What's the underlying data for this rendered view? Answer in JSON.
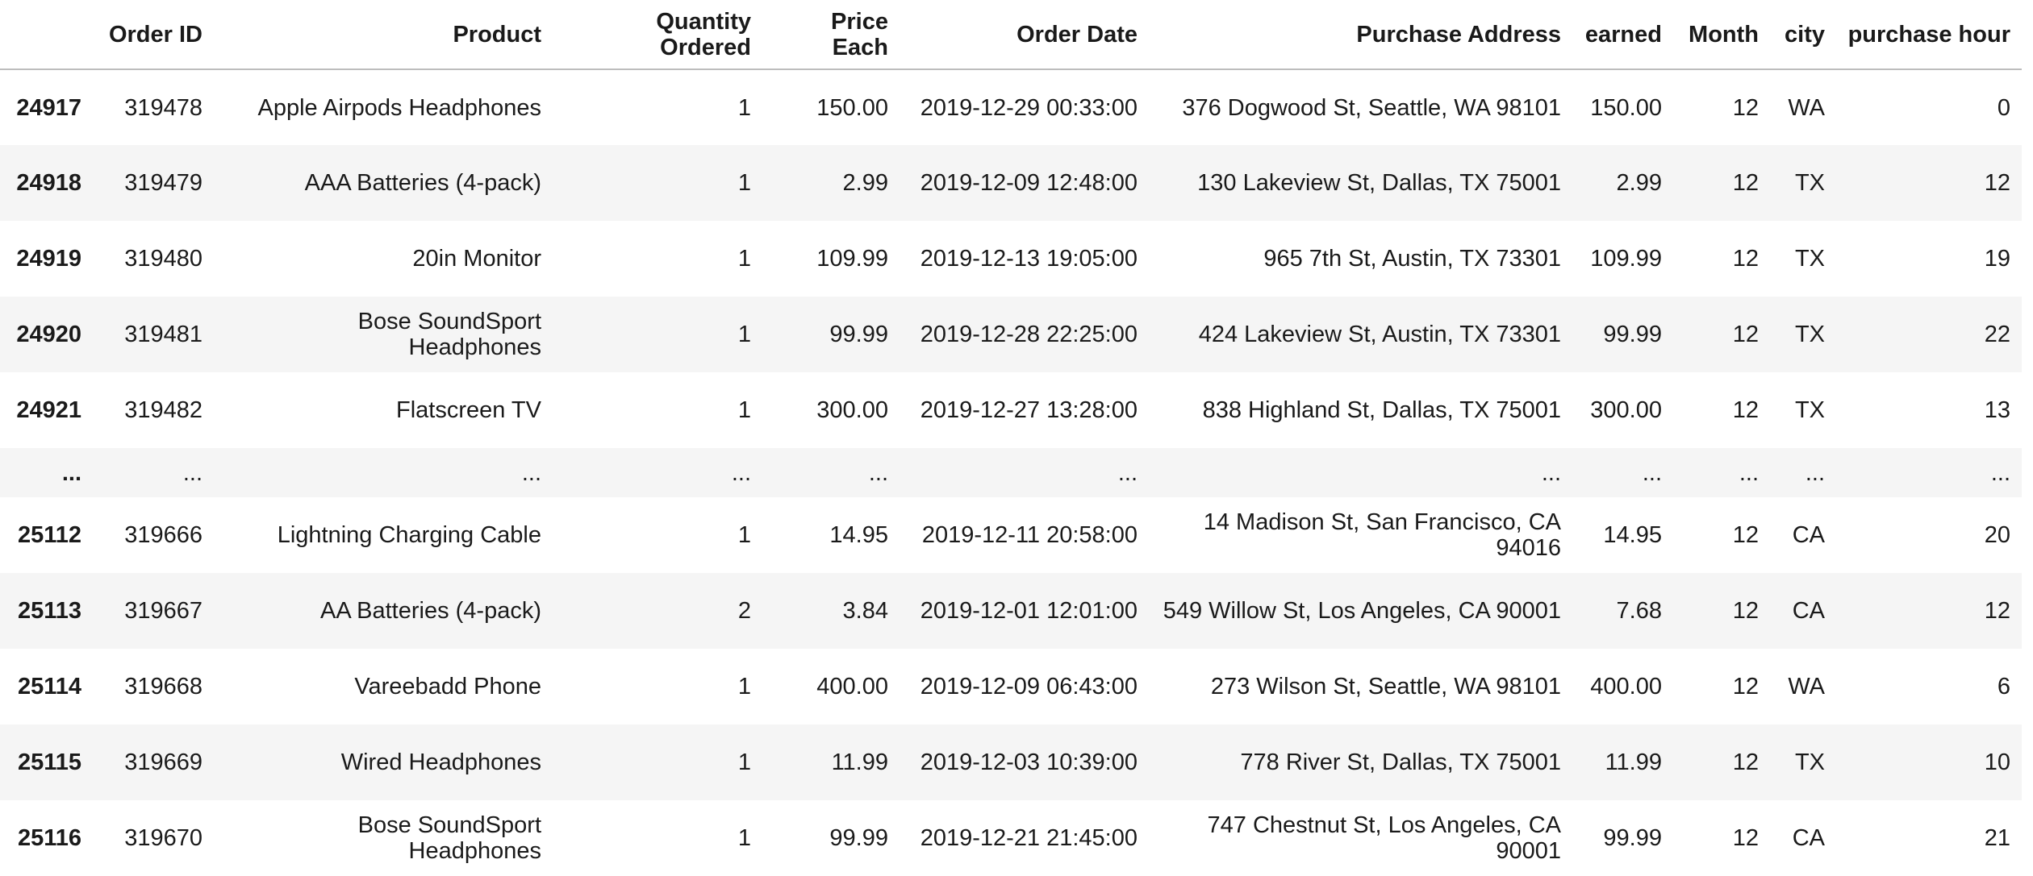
{
  "table": {
    "columns": [
      "",
      "Order ID",
      "Product",
      "Quantity Ordered",
      "Price Each",
      "Order Date",
      "Purchase Address",
      "earned",
      "Month",
      "city",
      "purchase hour"
    ],
    "rows": [
      {
        "index": "24917",
        "cells": [
          "319478",
          "Apple Airpods Headphones",
          "1",
          "150.00",
          "2019-12-29 00:33:00",
          "376 Dogwood St, Seattle, WA 98101",
          "150.00",
          "12",
          "WA",
          "0"
        ]
      },
      {
        "index": "24918",
        "cells": [
          "319479",
          "AAA Batteries (4-pack)",
          "1",
          "2.99",
          "2019-12-09 12:48:00",
          "130 Lakeview St, Dallas, TX 75001",
          "2.99",
          "12",
          "TX",
          "12"
        ]
      },
      {
        "index": "24919",
        "cells": [
          "319480",
          "20in Monitor",
          "1",
          "109.99",
          "2019-12-13 19:05:00",
          "965 7th St, Austin, TX 73301",
          "109.99",
          "12",
          "TX",
          "19"
        ]
      },
      {
        "index": "24920",
        "cells": [
          "319481",
          "Bose SoundSport Headphones",
          "1",
          "99.99",
          "2019-12-28 22:25:00",
          "424 Lakeview St, Austin, TX 73301",
          "99.99",
          "12",
          "TX",
          "22"
        ]
      },
      {
        "index": "24921",
        "cells": [
          "319482",
          "Flatscreen TV",
          "1",
          "300.00",
          "2019-12-27 13:28:00",
          "838 Highland St, Dallas, TX 75001",
          "300.00",
          "12",
          "TX",
          "13"
        ]
      },
      {
        "index": "...",
        "cells": [
          "...",
          "...",
          "...",
          "...",
          "...",
          "...",
          "...",
          "...",
          "...",
          "..."
        ]
      },
      {
        "index": "25112",
        "cells": [
          "319666",
          "Lightning Charging Cable",
          "1",
          "14.95",
          "2019-12-11 20:58:00",
          "14 Madison St, San Francisco, CA 94016",
          "14.95",
          "12",
          "CA",
          "20"
        ]
      },
      {
        "index": "25113",
        "cells": [
          "319667",
          "AA Batteries (4-pack)",
          "2",
          "3.84",
          "2019-12-01 12:01:00",
          "549 Willow St, Los Angeles, CA 90001",
          "7.68",
          "12",
          "CA",
          "12"
        ]
      },
      {
        "index": "25114",
        "cells": [
          "319668",
          "Vareebadd Phone",
          "1",
          "400.00",
          "2019-12-09 06:43:00",
          "273 Wilson St, Seattle, WA 98101",
          "400.00",
          "12",
          "WA",
          "6"
        ]
      },
      {
        "index": "25115",
        "cells": [
          "319669",
          "Wired Headphones",
          "1",
          "11.99",
          "2019-12-03 10:39:00",
          "778 River St, Dallas, TX 75001",
          "11.99",
          "12",
          "TX",
          "10"
        ]
      },
      {
        "index": "25116",
        "cells": [
          "319670",
          "Bose SoundSport Headphones",
          "1",
          "99.99",
          "2019-12-21 21:45:00",
          "747 Chestnut St, Los Angeles, CA 90001",
          "99.99",
          "12",
          "CA",
          "21"
        ]
      }
    ]
  }
}
